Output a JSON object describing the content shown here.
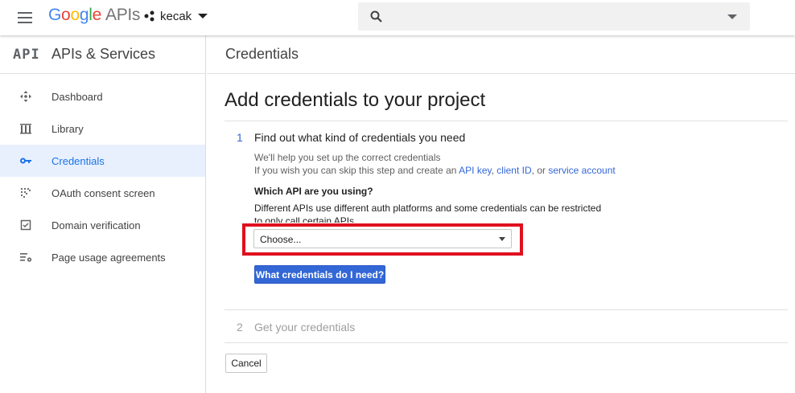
{
  "header": {
    "logo": {
      "g1": "G",
      "g2": "o",
      "g3": "o",
      "g4": "g",
      "g5": "l",
      "g6": "e",
      "apis": "APIs"
    },
    "project": "kecak",
    "search_placeholder": ""
  },
  "sidebar": {
    "api_mark": "API",
    "title": "APIs & Services",
    "items": [
      {
        "label": "Dashboard",
        "icon": "dashboard-icon",
        "active": false
      },
      {
        "label": "Library",
        "icon": "library-icon",
        "active": false
      },
      {
        "label": "Credentials",
        "icon": "key-icon",
        "active": true
      },
      {
        "label": "OAuth consent screen",
        "icon": "oauth-consent-icon",
        "active": false
      },
      {
        "label": "Domain verification",
        "icon": "checkbox-icon",
        "active": false
      },
      {
        "label": "Page usage agreements",
        "icon": "settings-list-icon",
        "active": false
      }
    ]
  },
  "main": {
    "header_title": "Credentials",
    "page_title": "Add credentials to your project",
    "step1": {
      "number": "1",
      "title": "Find out what kind of credentials you need",
      "help_line1": "We'll help you set up the correct credentials",
      "help_line2_prefix": "If you wish you can skip this step and create an ",
      "link_api_key": "API key",
      "sep1": ", ",
      "link_client_id": "client ID",
      "sep2": ", or ",
      "link_service_account": "service account",
      "question_label": "Which API are you using?",
      "question_text": "Different APIs use different auth platforms and some credentials can be restricted to only call certain APIs.",
      "select_value": "Choose...",
      "button": "What credentials do I need?"
    },
    "step2": {
      "number": "2",
      "title": "Get your credentials"
    },
    "cancel": "Cancel"
  },
  "colors": {
    "accent": "#3367d6",
    "highlight": "#e0101f",
    "active_bg": "#e8f0fe",
    "active_text": "#1a73e8"
  }
}
